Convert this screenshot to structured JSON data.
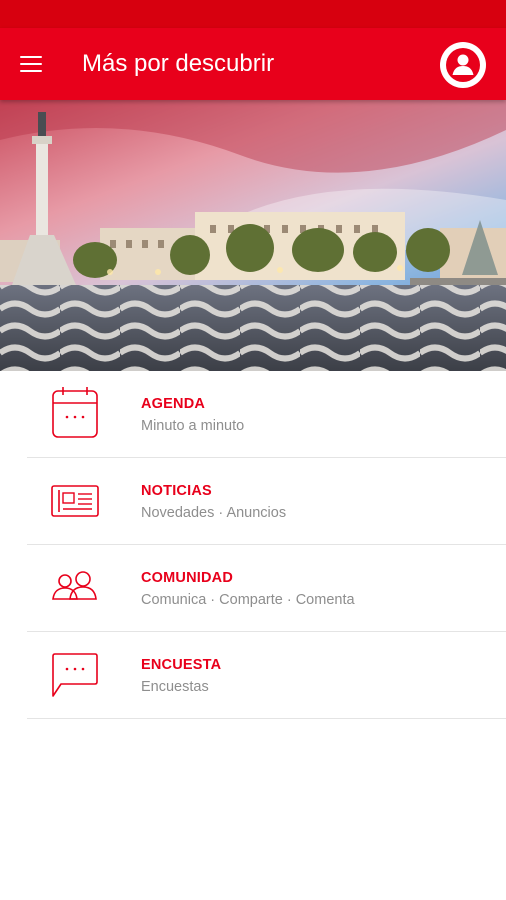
{
  "app_bar": {
    "title": "Más por descubrir",
    "menu_icon": "hamburger-menu-icon",
    "profile_icon": "user-avatar-icon"
  },
  "hero": {
    "image": "lisbon-rossio-square-photo"
  },
  "menu": {
    "items": [
      {
        "title": "AGENDA",
        "subtitle": "Minuto a minuto",
        "icon": "calendar-icon"
      },
      {
        "title": "NOTICIAS",
        "subtitle": "Novedades · Anuncios",
        "icon": "newspaper-icon"
      },
      {
        "title": "COMUNIDAD",
        "subtitle": "Comunica · Comparte · Comenta",
        "icon": "users-icon"
      },
      {
        "title": "ENCUESTA",
        "subtitle": "Encuestas",
        "icon": "chat-bubble-icon"
      }
    ]
  },
  "colors": {
    "brand_red": "#e8001b",
    "status_bar_red": "#d7000f",
    "subtitle_gray": "#8e8e8e",
    "divider_gray": "#e4e4e4"
  }
}
